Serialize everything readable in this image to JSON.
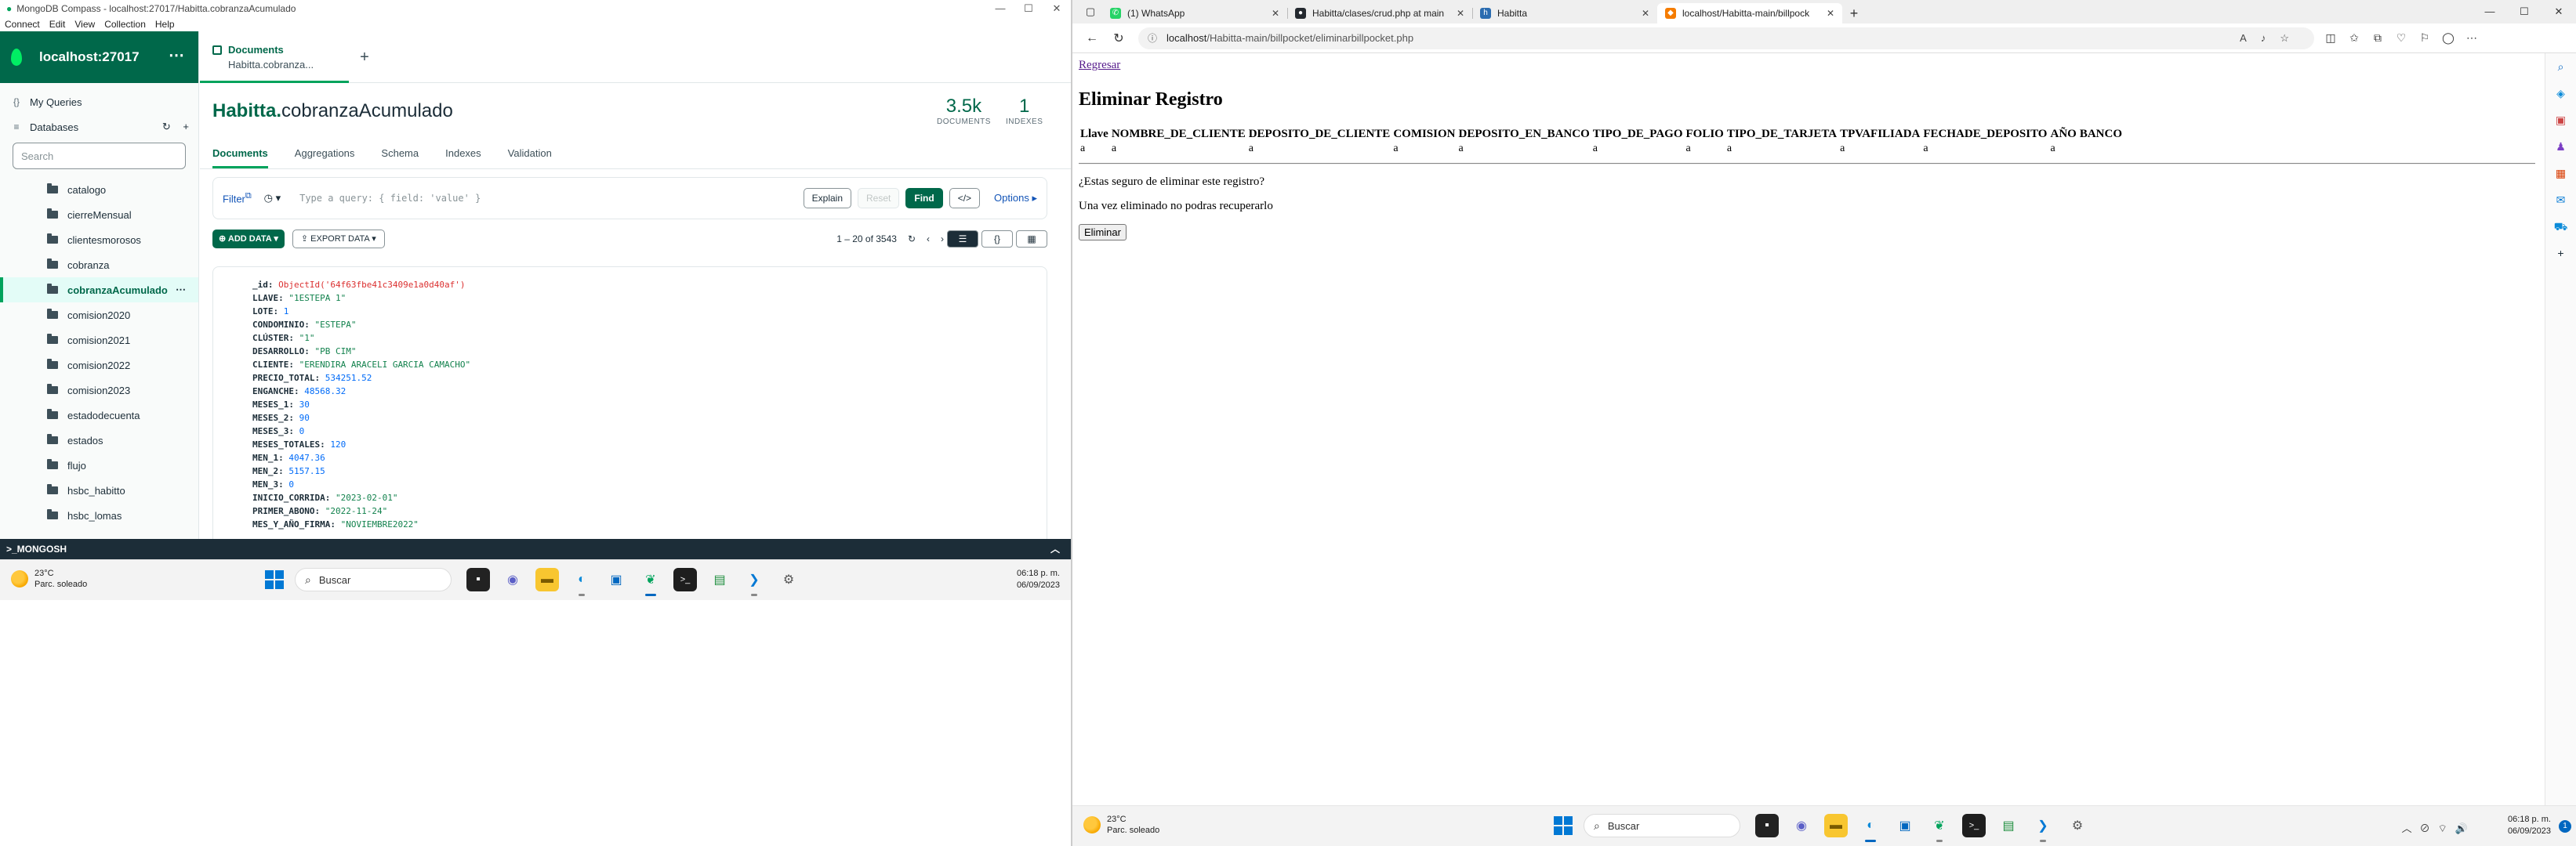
{
  "compass": {
    "window_title": "MongoDB Compass - localhost:27017/Habitta.cobranzaAcumulado",
    "menu": [
      "Connect",
      "Edit",
      "View",
      "Collection",
      "Help"
    ],
    "connection": "localhost:27017",
    "sidebar": {
      "my_queries": "My Queries",
      "databases": "Databases",
      "search_placeholder": "Search",
      "collections": [
        "catalogo",
        "cierreMensual",
        "clientesmorosos",
        "cobranza",
        "cobranzaAcumulado",
        "comision2020",
        "comision2021",
        "comision2022",
        "comision2023",
        "estadodecuenta",
        "estados",
        "flujo",
        "hsbc_habitto",
        "hsbc_lomas"
      ],
      "active_collection": "cobranzaAcumulado"
    },
    "tab": {
      "title": "Documents",
      "subtitle": "Habitta.cobranza..."
    },
    "namespace": {
      "db": "Habitta.",
      "collection": "cobranzaAcumulado"
    },
    "stats": {
      "documents_value": "3.5k",
      "documents_label": "DOCUMENTS",
      "indexes_value": "1",
      "indexes_label": "INDEXES"
    },
    "subtabs": [
      "Documents",
      "Aggregations",
      "Schema",
      "Indexes",
      "Validation"
    ],
    "query": {
      "filter_label": "Filter",
      "placeholder": "Type a query: { field: 'value' }",
      "explain": "Explain",
      "reset": "Reset",
      "find": "Find",
      "options": "Options"
    },
    "toolbar": {
      "add_data": "ADD DATA",
      "export_data": "EXPORT DATA",
      "pagination": "1 – 20 of 3543"
    },
    "document": [
      {
        "key": "_id:",
        "value": "ObjectId('64f63fbe41c3409e1a0d40af')",
        "type": "oid"
      },
      {
        "key": "LLAVE:",
        "value": "\"1ESTEPA 1\"",
        "type": "s"
      },
      {
        "key": "LOTE:",
        "value": "1",
        "type": "n"
      },
      {
        "key": "CONDOMINIO:",
        "value": "\"ESTEPA\"",
        "type": "s"
      },
      {
        "key": "CLÚSTER:",
        "value": "\"1\"",
        "type": "s"
      },
      {
        "key": "DESARROLLO:",
        "value": "\"PB CIM\"",
        "type": "s"
      },
      {
        "key": "CLIENTE:",
        "value": "\"ERENDIRA ARACELI GARCIA CAMACHO\"",
        "type": "s"
      },
      {
        "key": "PRECIO_TOTAL:",
        "value": "534251.52",
        "type": "n"
      },
      {
        "key": "ENGANCHE:",
        "value": "48568.32",
        "type": "n"
      },
      {
        "key": "MESES_1:",
        "value": "30",
        "type": "n"
      },
      {
        "key": "MESES_2:",
        "value": "90",
        "type": "n"
      },
      {
        "key": "MESES_3:",
        "value": "0",
        "type": "n"
      },
      {
        "key": "MESES_TOTALES:",
        "value": "120",
        "type": "n"
      },
      {
        "key": "MEN_1:",
        "value": "4047.36",
        "type": "n"
      },
      {
        "key": "MEN_2:",
        "value": "5157.15",
        "type": "n"
      },
      {
        "key": "MEN_3:",
        "value": "0",
        "type": "n"
      },
      {
        "key": "INICIO_CORRIDA:",
        "value": "\"2023-02-01\"",
        "type": "s"
      },
      {
        "key": "PRIMER_ABONO:",
        "value": "\"2022-11-24\"",
        "type": "s"
      },
      {
        "key": "MES_Y_AÑO_FIRMA:",
        "value": "\"NOVIEMBRE2022\"",
        "type": "s"
      }
    ],
    "mongosh": ">_MONGOSH",
    "taskbar": {
      "temp": "23°C",
      "weather": "Parc. soleado",
      "search": "Buscar",
      "time": "06:18 p. m.",
      "date": "06/09/2023"
    }
  },
  "edge": {
    "tabs": [
      {
        "title": "(1) WhatsApp",
        "favicon": "#25d366"
      },
      {
        "title": "Habitta/clases/crud.php at main",
        "favicon": "#24292f"
      },
      {
        "title": "Habitta",
        "favicon": "#2b6cb0"
      },
      {
        "title": "localhost/Habitta-main/billpock",
        "favicon": "#f57c00"
      }
    ],
    "url_host": "localhost",
    "url_path": "/Habitta-main/billpocket/eliminarbillpocket.php",
    "page": {
      "back_link": "Regresar",
      "heading": "Eliminar Registro",
      "columns": [
        "Llave",
        "NOMBRE_DE_CLIENTE",
        "DEPOSITO_DE_CLIENTE",
        "COMISION",
        "DEPOSITO_EN_BANCO",
        "TIPO_DE_PAGO",
        "FOLIO",
        "TIPO_DE_TARJETA",
        "TPVAFILIADA",
        "FECHADE_DEPOSITO",
        "AÑO",
        "BANCO"
      ],
      "row": [
        "a",
        "a",
        "a",
        "a",
        "a",
        "a",
        "a",
        "a",
        "a",
        "a",
        "a",
        ""
      ],
      "confirm_question": "¿Estas seguro de eliminar este registro?",
      "warning": "Una vez eliminado no podras recuperarlo",
      "delete_button": "Eliminar"
    },
    "taskbar": {
      "temp": "23°C",
      "weather": "Parc. soleado",
      "search": "Buscar",
      "time": "06:18 p. m.",
      "date": "06/09/2023",
      "notifications": "1"
    }
  }
}
